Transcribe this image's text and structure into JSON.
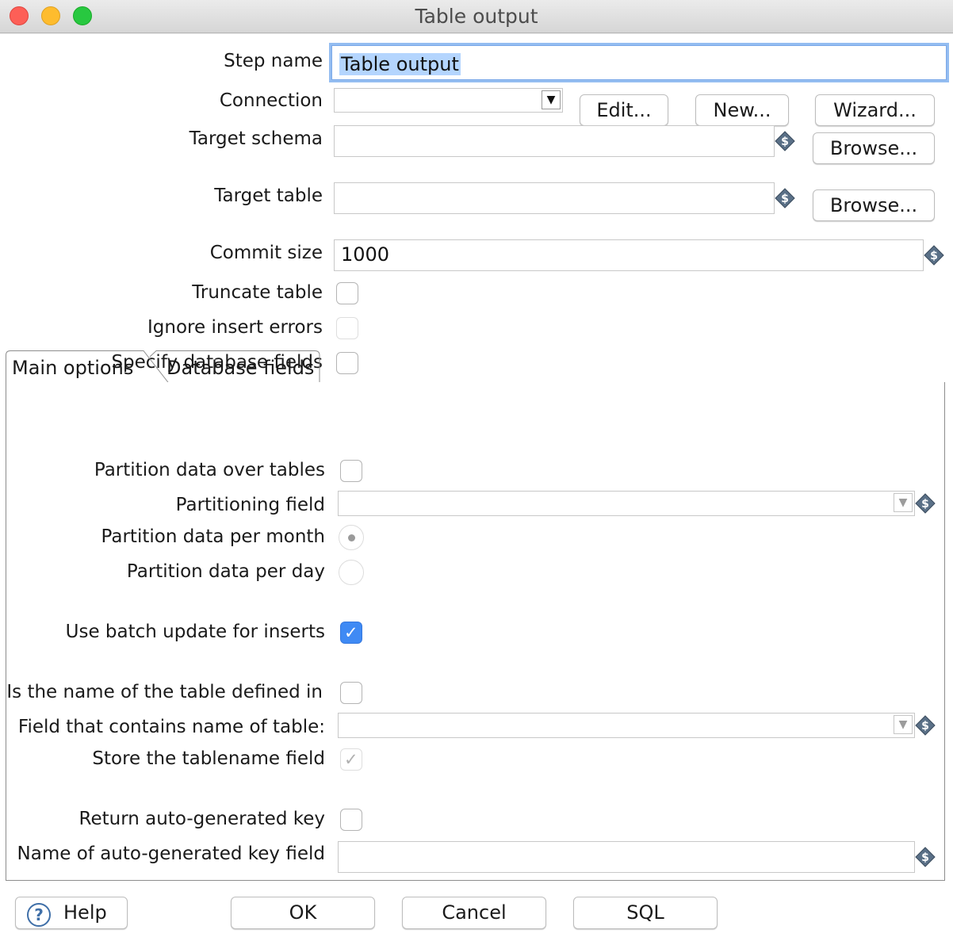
{
  "window": {
    "title": "Table output"
  },
  "form": {
    "step_name_label": "Step name",
    "step_name_value": "Table output",
    "connection_label": "Connection",
    "connection_value": "",
    "edit_button": "Edit...",
    "new_button": "New...",
    "wizard_button": "Wizard...",
    "target_schema_label": "Target schema",
    "target_schema_value": "",
    "browse_schema_button": "Browse...",
    "target_table_label": "Target table",
    "target_table_value": "",
    "browse_table_button": "Browse...",
    "commit_size_label": "Commit size",
    "commit_size_value": "1000",
    "truncate_label": "Truncate table",
    "truncate_checked": false,
    "ignore_errors_label": "Ignore insert errors",
    "ignore_errors_checked": false,
    "specify_fields_label": "Specify database fields",
    "specify_fields_checked": false
  },
  "tabs": [
    {
      "label": "Main options",
      "active": true
    },
    {
      "label": "Database fields",
      "active": false
    }
  ],
  "main_options": {
    "partition_over_tables_label": "Partition data over tables",
    "partition_over_tables_checked": false,
    "partitioning_field_label": "Partitioning field",
    "partitioning_field_value": "",
    "per_month_label": "Partition data per month",
    "per_month_selected": true,
    "per_day_label": "Partition data per day",
    "per_day_selected": false,
    "batch_update_label": "Use batch update for inserts",
    "batch_update_checked": true,
    "table_name_in_field_label": "Is the name of the table defined in",
    "table_name_in_field_checked": false,
    "field_with_table_name_label": "Field that contains name of table:",
    "field_with_table_name_value": "",
    "store_tablename_label": "Store the tablename field",
    "store_tablename_checked": true,
    "return_key_label": "Return auto-generated key",
    "return_key_checked": false,
    "key_field_name_label": "Name of auto-generated key field",
    "key_field_name_value": ""
  },
  "buttons": {
    "help": "Help",
    "ok": "OK",
    "cancel": "Cancel",
    "sql": "SQL"
  },
  "icons": {
    "variable": "variable-dollar-icon",
    "help": "help-question-icon",
    "dropdown": "dropdown-arrow-icon"
  },
  "colors": {
    "accent": "#3f8af4",
    "focus_ring": "#94bdf1",
    "selection": "#b4d5fe"
  }
}
